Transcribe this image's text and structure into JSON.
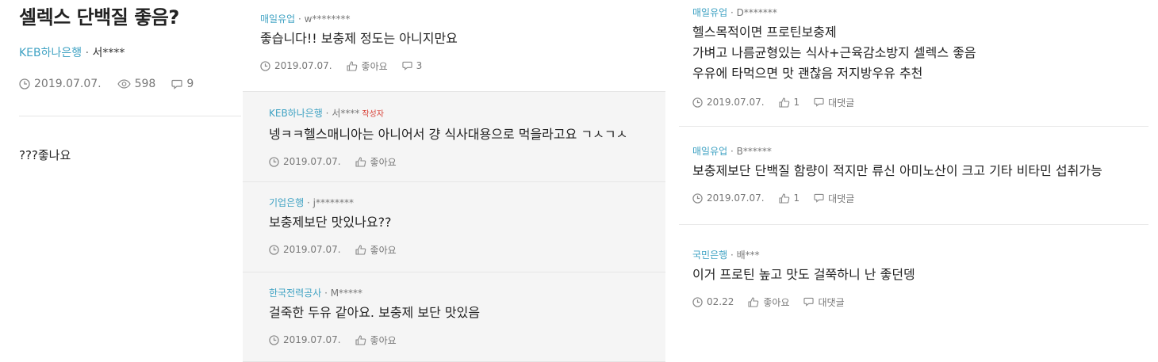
{
  "post": {
    "title": "셀렉스 단백질 좋음?",
    "company": "KEB하나은행",
    "author": "서****",
    "date": "2019.07.07.",
    "views": "598",
    "comments": "9",
    "body": "???좋나요"
  },
  "comments": [
    {
      "company": "매일유업",
      "author": "w********",
      "badge": "",
      "text": [
        "좋습니다!! 보충제 정도는 아니지만요"
      ],
      "date": "2019.07.07.",
      "like": "좋아요",
      "reply": "3"
    },
    {
      "company": "KEB하나은행",
      "author": "서****",
      "badge": "작성자",
      "text": [
        "넹ㅋㅋ헬스매니아는 아니어서 걍 식사대용으로 먹을라고요 ㄱㅅㄱㅅ"
      ],
      "date": "2019.07.07.",
      "like": "좋아요",
      "reply": ""
    },
    {
      "company": "기업은행",
      "author": "j********",
      "badge": "",
      "text": [
        "보충제보단 맛있나요??"
      ],
      "date": "2019.07.07.",
      "like": "좋아요",
      "reply": ""
    },
    {
      "company": "한국전력공사",
      "author": "M*****",
      "badge": "",
      "text": [
        "걸죽한 두유 같아요. 보충제 보단 맛있음"
      ],
      "date": "2019.07.07.",
      "like": "좋아요",
      "reply": ""
    },
    {
      "company": "매일유업",
      "author": "D*******",
      "badge": "",
      "text": [
        "헬스목적이면 프로틴보충제",
        "가벼고 나름균형있는 식사+근육감소방지 셀렉스 좋음",
        "우유에 타먹으면 맛 괜찮음 저지방우유 추천"
      ],
      "date": "2019.07.07.",
      "like": "1",
      "reply": "대댓글"
    },
    {
      "company": "매일유업",
      "author": "B******",
      "badge": "",
      "text": [
        "보충제보단 단백질 함량이 적지만 류신 아미노산이 크고 기타 비타민 섭취가능"
      ],
      "date": "2019.07.07.",
      "like": "1",
      "reply": "대댓글"
    },
    {
      "company": "국민은행",
      "author": "배***",
      "badge": "",
      "text": [
        "이거 프로틴 높고 맛도 걸쭉하니 난 좋던뎅"
      ],
      "date": "02.22",
      "like": "좋아요",
      "reply": "대댓글"
    }
  ],
  "icons": {
    "clock": "clock-icon",
    "eye": "eye-icon",
    "comment": "comment-icon",
    "thumb": "thumbs-up-icon"
  },
  "colors": {
    "company": "#3fa2c3",
    "badge": "#d9443a",
    "reply_bg": "#f5f5f5"
  }
}
